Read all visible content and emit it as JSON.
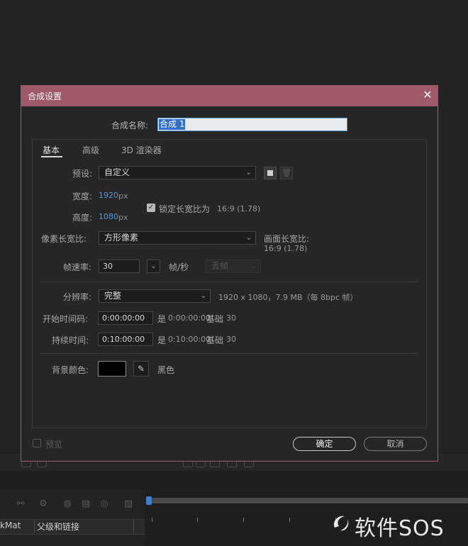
{
  "dialog": {
    "title": "合成设置",
    "close_glyph": "✕",
    "name_label": "合成名称:",
    "name_value": "合成 1"
  },
  "tabs": [
    {
      "label": "基本",
      "active": true
    },
    {
      "label": "高级",
      "active": false
    },
    {
      "label": "3D 渲染器",
      "active": false
    }
  ],
  "basic": {
    "preset_label": "预设:",
    "preset_value": "自定义",
    "width_label": "宽度:",
    "width_value": "1920",
    "width_unit": "px",
    "height_label": "高度:",
    "height_value": "1080",
    "height_unit": "px",
    "lock_label": "锁定长宽比为",
    "lock_ratio": "16:9 (1.78)",
    "lock_checked": true,
    "pixel_aspect_label": "像素长宽比:",
    "pixel_aspect_value": "方形像素",
    "frame_aspect_label": "画面长宽比:",
    "frame_aspect_value": "16:9 (1.78)",
    "fps_label": "帧速率:",
    "fps_value": "30",
    "fps_unit": "帧/秒",
    "drop_frame_value": "丢帧",
    "resolution_label": "分辨率:",
    "resolution_value": "完整",
    "resolution_info": "1920 x 1080，7.9 MB（每 8bpc 帧）",
    "start_tc_label": "开始时间码:",
    "start_tc_value": "0:00:00:00",
    "start_tc_is": "是",
    "start_tc_equiv": "0:00:00:00",
    "start_tc_base": "基础",
    "start_tc_base_value": "30",
    "duration_label": "持续时间:",
    "duration_value": "0:10:00:00",
    "duration_is": "是",
    "duration_equiv": "0:10:00:00",
    "duration_base": "基础",
    "duration_base_value": "30",
    "bg_color_label": "背景颜色:",
    "bg_color_hex": "#000000",
    "bg_color_name": "黑色"
  },
  "footer": {
    "preview_label": "预览",
    "ok_label": "确定",
    "cancel_label": "取消"
  },
  "background_app": {
    "col_mat": "kMat",
    "col_parent": "父级和链接",
    "watermark": "软件SOS"
  },
  "colors": {
    "titlebar": "#9e5a6a",
    "accent_blue": "#4a9de0",
    "selection": "#2f6fc9"
  }
}
